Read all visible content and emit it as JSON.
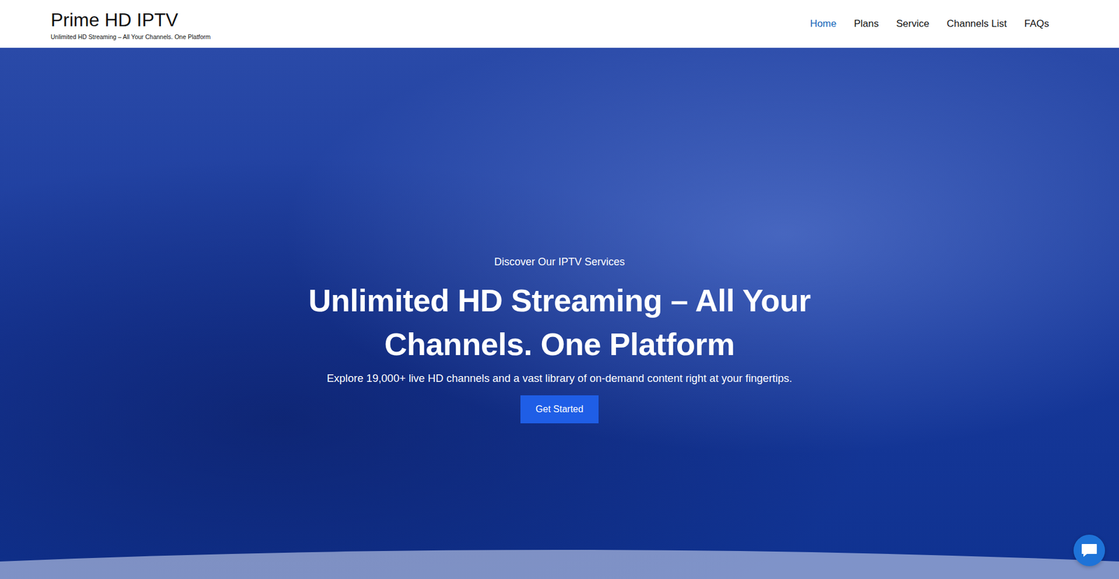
{
  "site": {
    "title": "Prime HD IPTV",
    "tagline": "Unlimited HD Streaming – All Your Channels. One Platform"
  },
  "nav": [
    {
      "label": "Home",
      "selected": true
    },
    {
      "label": "Plans",
      "selected": false
    },
    {
      "label": "Service",
      "selected": false
    },
    {
      "label": "Channels List",
      "selected": false
    },
    {
      "label": "FAQs",
      "selected": false
    }
  ],
  "hero": {
    "eyebrow": "Discover Our IPTV Services",
    "title": "Unlimited HD Streaming – All Your Channels. One Platform",
    "description": "Explore 19,000+ live HD channels and a vast library of on-demand content right at your fingertips.",
    "button": "Get Started"
  }
}
